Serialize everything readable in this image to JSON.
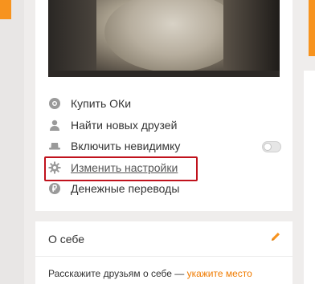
{
  "menu": {
    "items": [
      {
        "label": "Купить ОКи",
        "icon": "coin-icon"
      },
      {
        "label": "Найти новых друзей",
        "icon": "person-icon"
      },
      {
        "label": "Включить невидимку",
        "icon": "hat-icon",
        "toggle_on": false
      },
      {
        "label": "Изменить настройки",
        "icon": "gear-icon",
        "highlighted": true
      },
      {
        "label": "Денежные переводы",
        "icon": "ruble-icon"
      }
    ]
  },
  "about": {
    "title": "О себе",
    "prompt_text": "Расскажите друзьям о себе — ",
    "prompt_link": "укажите место"
  },
  "colors": {
    "accent": "#f7931e",
    "highlight_border": "#c0121c",
    "icon_gray": "#9a9a9a",
    "background": "#efedec"
  }
}
